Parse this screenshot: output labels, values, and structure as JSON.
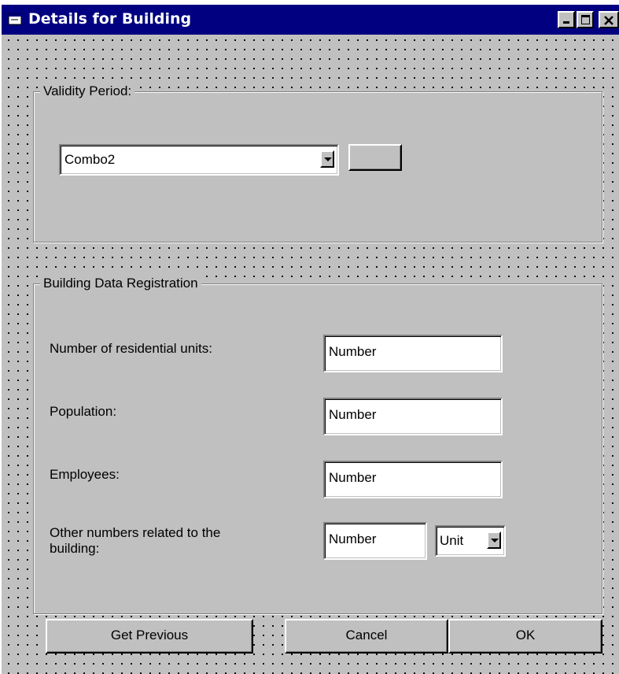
{
  "window": {
    "title": "Details for Building"
  },
  "validity": {
    "legend": "Validity Period:",
    "combo_value": "Combo2"
  },
  "registration": {
    "legend": "Building Data Registration",
    "fields": [
      {
        "label": "Number of residential units:",
        "value": "Number"
      },
      {
        "label": "Population:",
        "value": "Number"
      },
      {
        "label": "Employees:",
        "value": "Number"
      },
      {
        "label_line1": "Other numbers related to the",
        "label_line2": "building:",
        "value": "Number",
        "unit": "Unit"
      }
    ]
  },
  "buttons": {
    "get_previous": "Get Previous",
    "cancel": "Cancel",
    "ok": "OK"
  },
  "icons": {
    "app": "window-app-icon",
    "minimize": "minimize-icon",
    "maximize": "maximize-icon",
    "close": "close-icon",
    "dropdown": "chevron-down-icon"
  }
}
